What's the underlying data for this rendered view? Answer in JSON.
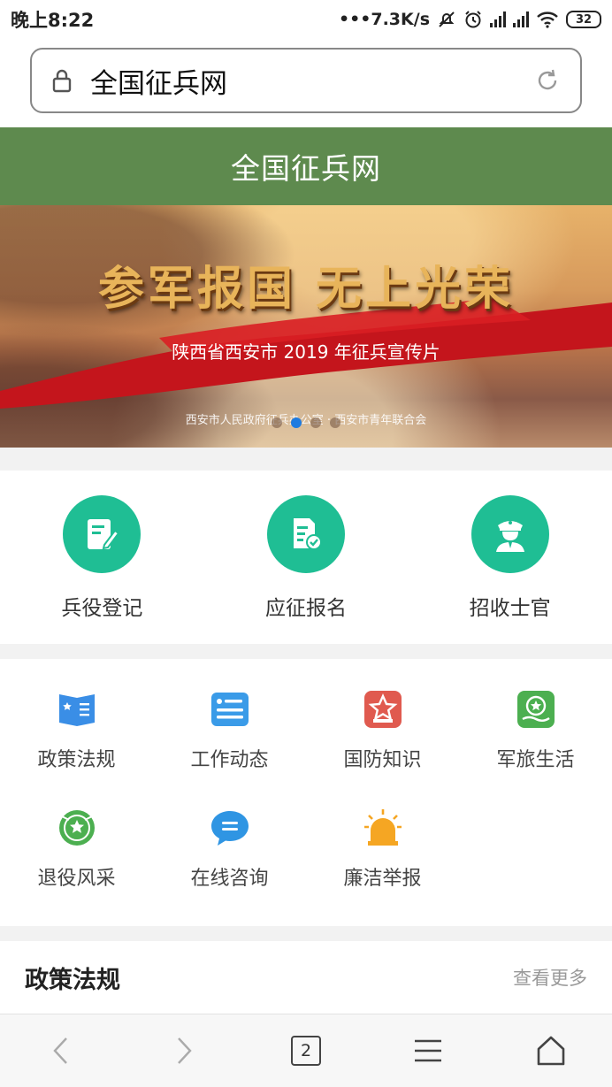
{
  "status_bar": {
    "time": "晚上8:22",
    "network_speed": "•••7.3K/s",
    "battery": "32"
  },
  "address_bar": {
    "url_text": "全国征兵网"
  },
  "header": {
    "title": "全国征兵网"
  },
  "banner": {
    "slogan": "参军报国 无上光荣",
    "subtitle": "陕西省西安市 2019 年征兵宣传片",
    "organization": "西安市人民政府征兵办公室 · 西安市青年联合会",
    "slide_count": 4,
    "active_slide": 2
  },
  "quick_actions": [
    {
      "label": "兵役登记",
      "icon": "edit-form-icon"
    },
    {
      "label": "应征报名",
      "icon": "document-check-icon"
    },
    {
      "label": "招收士官",
      "icon": "officer-icon"
    }
  ],
  "categories": [
    {
      "label": "政策法规",
      "icon": "policy-book-icon",
      "color": "#3a8ee6"
    },
    {
      "label": "工作动态",
      "icon": "news-card-icon",
      "color": "#3a9be8"
    },
    {
      "label": "国防知识",
      "icon": "defense-emblem-icon",
      "color": "#e05a4f"
    },
    {
      "label": "军旅生活",
      "icon": "military-life-icon",
      "color": "#4caf50"
    },
    {
      "label": "退役风采",
      "icon": "veteran-badge-icon",
      "color": "#4caf50"
    },
    {
      "label": "在线咨询",
      "icon": "chat-bubble-icon",
      "color": "#2f95e3"
    },
    {
      "label": "廉洁举报",
      "icon": "alarm-light-icon",
      "color": "#f5a623"
    }
  ],
  "section": {
    "title": "政策法规",
    "more": "查看更多"
  },
  "bottom_nav": {
    "tab_count": "2"
  }
}
